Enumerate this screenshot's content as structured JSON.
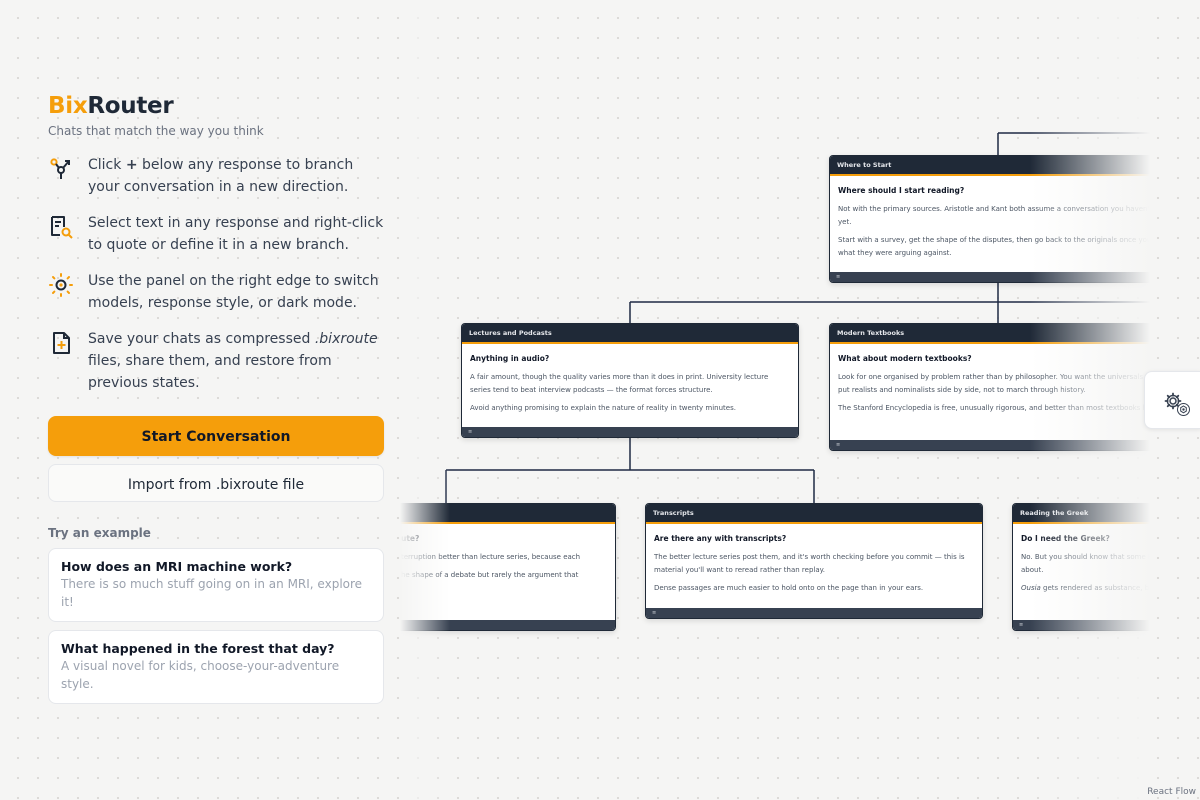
{
  "brand": {
    "part1": "Bix",
    "part2": "Router",
    "tagline": "Chats that match the way you think"
  },
  "features": [
    {
      "icon": "branch-icon",
      "pre": "Click ",
      "bold": "+",
      "post": " below any response to branch your conversation in a new direction."
    },
    {
      "icon": "select-quote-icon",
      "text": "Select text in any response and right-click to quote or define it in a new branch."
    },
    {
      "icon": "sun-settings-icon",
      "text": "Use the panel on the right edge to switch models, response style, or dark mode."
    },
    {
      "icon": "save-file-icon",
      "pre": "Save your chats as compressed ",
      "italic": ".bixroute",
      "post": " files, share them, and restore from previous states."
    }
  ],
  "buttons": {
    "start": "Start Conversation",
    "import": "Import from .bixroute file"
  },
  "examples_heading": "Try an example",
  "examples": [
    {
      "title": "How does an MRI machine work?",
      "subtitle": "There is so much stuff going on in an MRI, explore it!"
    },
    {
      "title": "What happened in the forest that day?",
      "subtitle": "A visual novel for kids, choose-your-adventure style."
    }
  ],
  "nodes": {
    "where": {
      "header": "Where to Start",
      "question": "Where should I start reading?",
      "p1": "Not with the primary sources. Aristotle and Kant both assume a conversation you haven't had yet.",
      "p2": "Start with a survey, get the shape of the disputes, then go back to the originals once you know what they were arguing against."
    },
    "lectures": {
      "header": "Lectures and Podcasts",
      "question": "Anything in audio?",
      "p1": "A fair amount, though the quality varies more than it does in print. University lecture series tend to beat interview podcasts — the format forces structure.",
      "p2": "Avoid anything promising to explain the nature of reality in twenty minutes."
    },
    "textbooks": {
      "header": "Modern Textbooks",
      "question": "What about modern textbooks?",
      "p1": "Look for one organised by problem rather than by philosopher. You want the universals chapter to put realists and nominalists side by side, not to march through history.",
      "p2": "The Stanford Encyclopedia is free, unusually rigorous, and better than most textbooks here."
    },
    "podcasts": {
      "header": "",
      "question": "ute?",
      "p1": "terruption better than lecture series, because each",
      "p2": "he shape of a debate but rarely the argument that"
    },
    "transcripts": {
      "header": "Transcripts",
      "question": "Are there any with transcripts?",
      "p1": "The better lecture series post them, and it's worth checking before you commit — this is material you'll want to reread rather than replay.",
      "p2": "Dense passages are much easier to hold onto on the page than in your ears."
    },
    "greek": {
      "header": "Reading the Greek",
      "question": "Do I need the Greek?",
      "p1": "No. But you should know that some key terms carry distinctions that translators quietly disagree about.",
      "p2_italic": "Ousia",
      "p2": " gets rendered as substance, being or essence, and the choice changes the argument."
    }
  },
  "footer_glyph": "≡",
  "attribution": "React Flow",
  "colors": {
    "accent": "#f59e0b",
    "node_header": "#1f2937",
    "edge": "#1f2a44",
    "background": "#f5f5f4"
  }
}
